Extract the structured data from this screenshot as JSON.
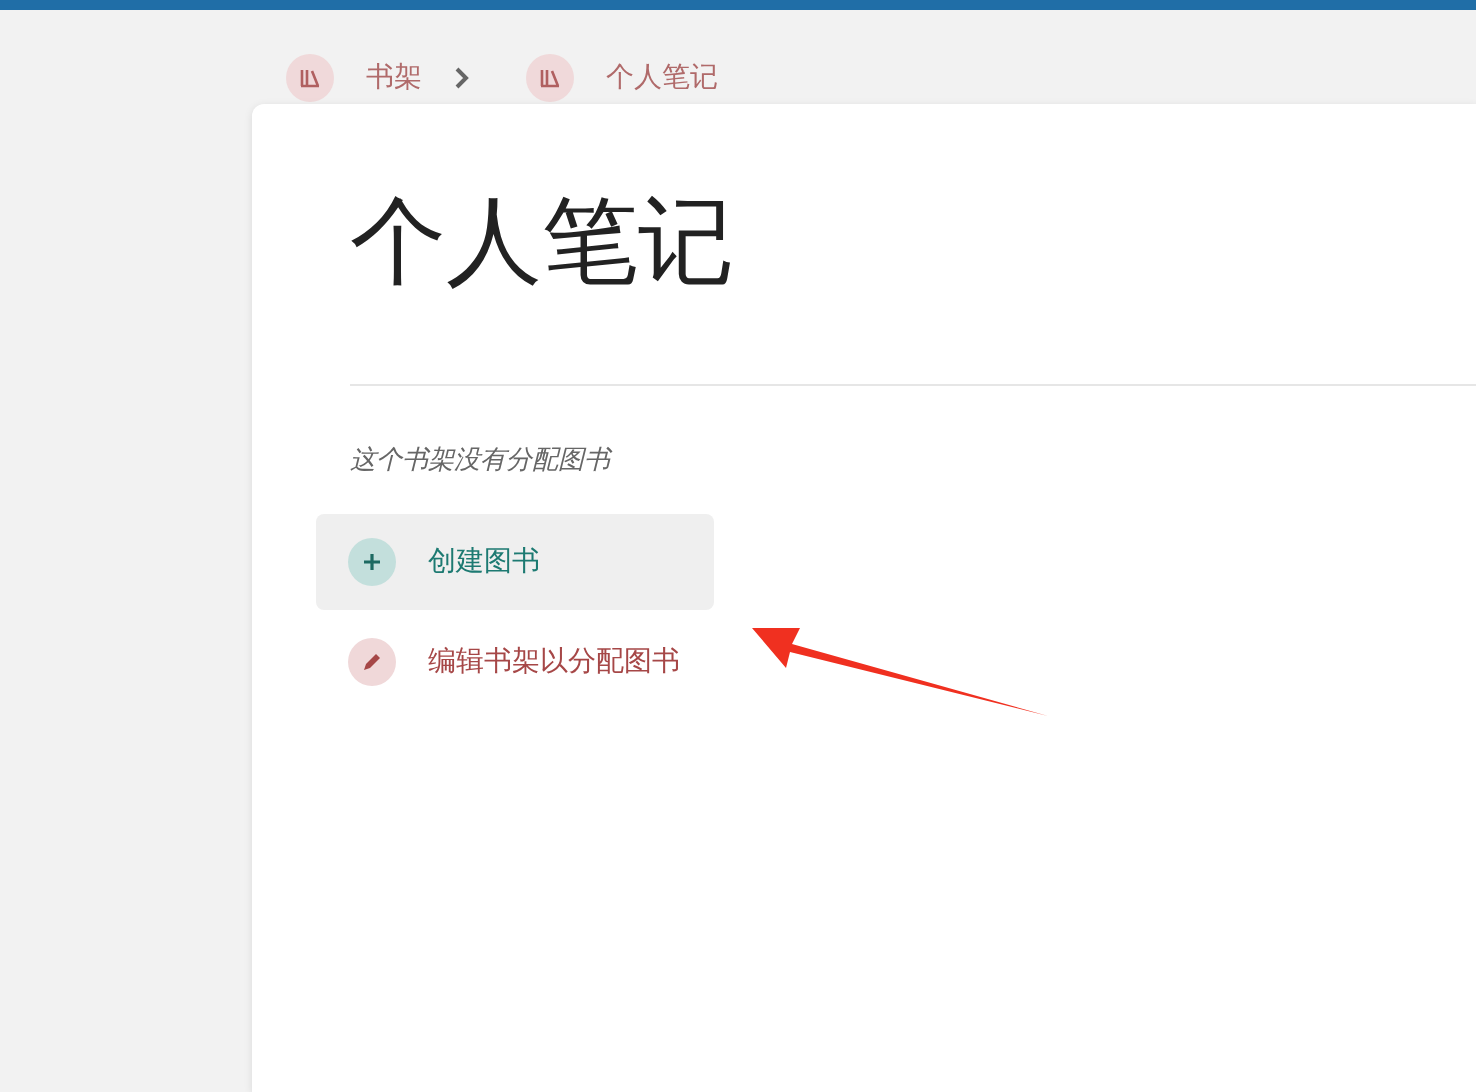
{
  "breadcrumb": [
    {
      "label": "书架"
    },
    {
      "label": "个人笔记"
    }
  ],
  "title": "个人笔记",
  "empty_message": "这个书架没有分配图书",
  "actions": [
    {
      "kind": "create",
      "label": "创建图书",
      "hovered": true
    },
    {
      "kind": "edit",
      "label": "编辑书架以分配图书",
      "hovered": false
    }
  ]
}
